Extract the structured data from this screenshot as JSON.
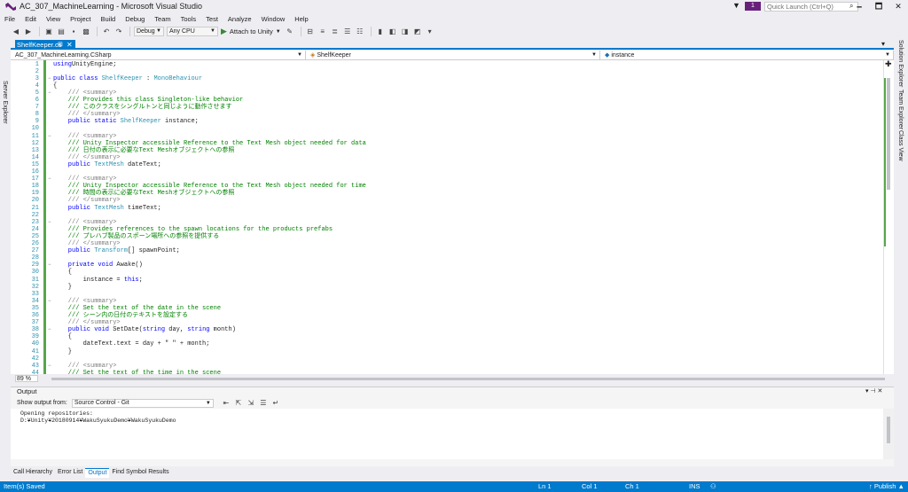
{
  "window": {
    "title": "AC_307_MachineLearning - Microsoft Visual Studio",
    "quick_launch_placeholder": "Quick Launch (Ctrl+Q)",
    "notification_count": "1",
    "buttons": {
      "minimize": "🗕",
      "maximize": "🗖",
      "close": "✕"
    }
  },
  "menu": [
    "File",
    "Edit",
    "View",
    "Project",
    "Build",
    "Debug",
    "Team",
    "Tools",
    "Test",
    "Analyze",
    "Window",
    "Help"
  ],
  "toolbar": {
    "configuration": "Debug",
    "platform": "Any CPU",
    "attach_label": "Attach to Unity"
  },
  "left_panel": {
    "server_explorer": "Server Explorer"
  },
  "right_panel": {
    "solution_explorer": "Solution Explorer",
    "team_explorer": "Team Explorer",
    "class_view": "Class View"
  },
  "document_tab": {
    "name": "ShelfKeeper.cs",
    "pin": "⊞",
    "close": "✕"
  },
  "navigation": {
    "project": "AC_307_MachineLearning.CSharp",
    "type": "ShelfKeeper",
    "member": "instance"
  },
  "code": {
    "line_numbers": [
      "1",
      "2",
      "3",
      "4",
      "5",
      "6",
      "7",
      "8",
      "9",
      "10",
      "11",
      "12",
      "13",
      "14",
      "15",
      "16",
      "17",
      "18",
      "19",
      "20",
      "21",
      "22",
      "23",
      "24",
      "25",
      "26",
      "27",
      "28",
      "29",
      "30",
      "31",
      "32",
      "33",
      "34",
      "35",
      "36",
      "37",
      "38",
      "39",
      "40",
      "41",
      "42",
      "43",
      "44"
    ],
    "lines": [
      [
        [
          "kw",
          "using"
        ],
        [
          "",
          "UnityEngine;"
        ]
      ],
      [],
      [
        [
          "kw",
          "public class "
        ],
        [
          "ty",
          "ShelfKeeper"
        ],
        [
          "",
          " : "
        ],
        [
          "ty",
          "MonoBehaviour"
        ]
      ],
      [
        [
          "",
          "{"
        ]
      ],
      [
        [
          "ct",
          "    /// <summary>"
        ]
      ],
      [
        [
          "cm",
          "    /// Provides this class Singleton-like behavior"
        ]
      ],
      [
        [
          "cm",
          "    /// このクラスをシングルトンと同じように動作させます"
        ]
      ],
      [
        [
          "ct",
          "    /// </summary>"
        ]
      ],
      [
        [
          "kw",
          "    public static "
        ],
        [
          "ty",
          "ShelfKeeper"
        ],
        [
          "",
          " instance;"
        ]
      ],
      [],
      [
        [
          "ct",
          "    /// <summary>"
        ]
      ],
      [
        [
          "cm",
          "    /// Unity Inspector accessible Reference to the Text Mesh object needed for data"
        ]
      ],
      [
        [
          "cm",
          "    /// 日付の表示に必要なText Meshオブジェクトへの参照"
        ]
      ],
      [
        [
          "ct",
          "    /// </summary>"
        ]
      ],
      [
        [
          "kw",
          "    public "
        ],
        [
          "ty",
          "TextMesh"
        ],
        [
          "",
          " dateText;"
        ]
      ],
      [],
      [
        [
          "ct",
          "    /// <summary>"
        ]
      ],
      [
        [
          "cm",
          "    /// Unity Inspector accessible Reference to the Text Mesh object needed for time"
        ]
      ],
      [
        [
          "cm",
          "    /// 時間の表示に必要なText Meshオブジェクトへの参照"
        ]
      ],
      [
        [
          "ct",
          "    /// </summary>"
        ]
      ],
      [
        [
          "kw",
          "    public "
        ],
        [
          "ty",
          "TextMesh"
        ],
        [
          "",
          " timeText;"
        ]
      ],
      [],
      [
        [
          "ct",
          "    /// <summary>"
        ]
      ],
      [
        [
          "cm",
          "    /// Provides references to the spawn locations for the products prefabs"
        ]
      ],
      [
        [
          "cm",
          "    /// プレハブ製品のスポーン場所への参照を提供する"
        ]
      ],
      [
        [
          "ct",
          "    /// </summary>"
        ]
      ],
      [
        [
          "kw",
          "    public "
        ],
        [
          "ty",
          "Transform"
        ],
        [
          "",
          "[] spawnPoint;"
        ]
      ],
      [],
      [
        [
          "kw",
          "    private void "
        ],
        [
          "",
          "Awake()"
        ]
      ],
      [
        [
          "",
          "    {"
        ]
      ],
      [
        [
          "",
          "        instance = "
        ],
        [
          "kw",
          "this"
        ],
        [
          "",
          ";"
        ]
      ],
      [
        [
          "",
          "    }"
        ]
      ],
      [],
      [
        [
          "ct",
          "    /// <summary>"
        ]
      ],
      [
        [
          "cm",
          "    /// Set the text of the date in the scene"
        ]
      ],
      [
        [
          "cm",
          "    /// シーン内の日付のテキストを設定する"
        ]
      ],
      [
        [
          "ct",
          "    /// </summary>"
        ]
      ],
      [
        [
          "kw",
          "    public void "
        ],
        [
          "",
          "SetDate("
        ],
        [
          "kw",
          "string"
        ],
        [
          "",
          " day, "
        ],
        [
          "kw",
          "string"
        ],
        [
          "",
          " month)"
        ]
      ],
      [
        [
          "",
          "    {"
        ]
      ],
      [
        [
          "",
          "        dateText.text = day + \" \" + month;"
        ]
      ],
      [
        [
          "",
          "    }"
        ]
      ],
      [],
      [
        [
          "ct",
          "    /// <summary>"
        ]
      ],
      [
        [
          "cm",
          "    /// Set the text of the time in the scene"
        ]
      ]
    ]
  },
  "editor_status": {
    "zoom": "89 %"
  },
  "output_panel": {
    "title": "Output",
    "show_from_label": "Show output from:",
    "source": "Source Control - Git",
    "text": "Opening repositories:\nD:¥Unity¥20180914¥WakuSyukuDemo¥WakuSyukuDemo"
  },
  "bottom_tabs": [
    "Call Hierarchy",
    "Error List",
    "Output",
    "Find Symbol Results"
  ],
  "bottom_tabs_active": "Output",
  "status": {
    "message": "Item(s) Saved",
    "line": "Ln 1",
    "col": "Col 1",
    "ch": "Ch 1",
    "mode": "INS",
    "publish": "↑ Publish ▲"
  },
  "colors": {
    "accent": "#007acc",
    "keyword": "#0000ff",
    "type": "#2b91af",
    "comment": "#008000"
  }
}
